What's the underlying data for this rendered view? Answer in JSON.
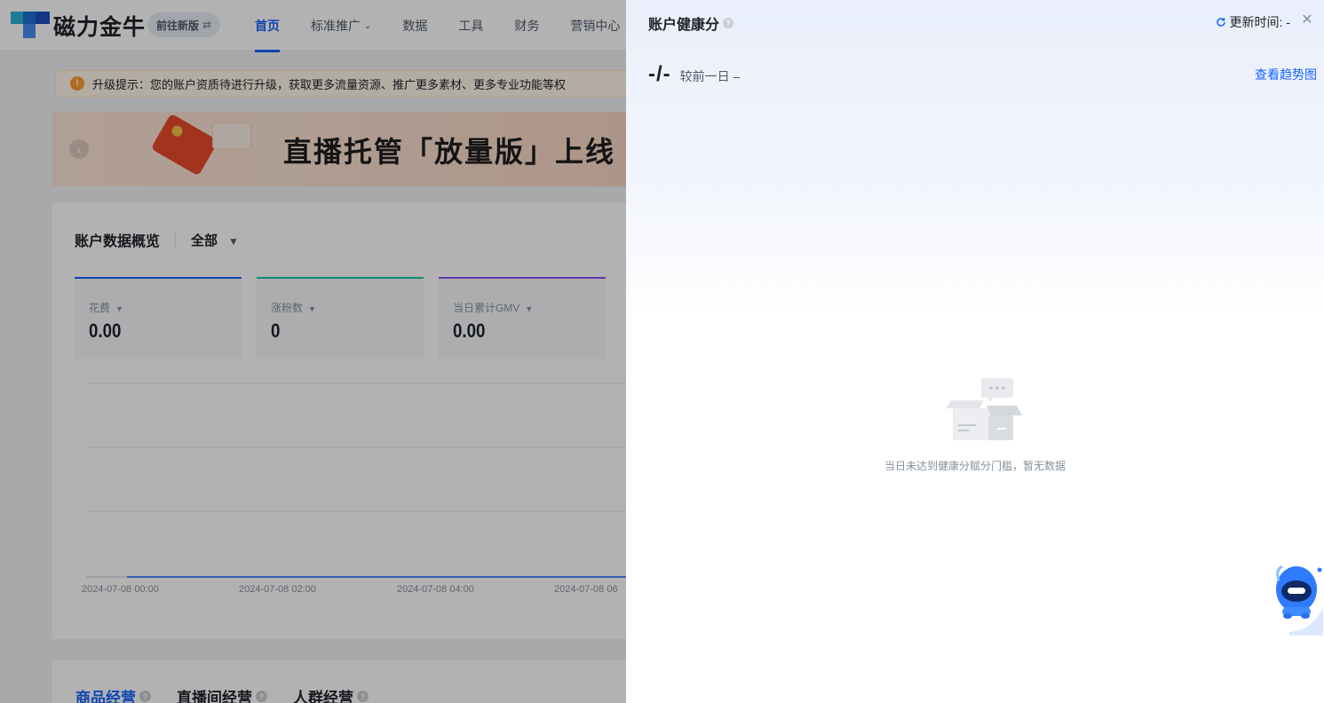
{
  "header": {
    "brand": "磁力金牛",
    "version_button": "前往新版",
    "version_icon": "swap-icon",
    "nav": [
      {
        "label": "首页",
        "active": true
      },
      {
        "label": "标准推广",
        "dropdown": true
      },
      {
        "label": "数据"
      },
      {
        "label": "工具"
      },
      {
        "label": "财务"
      },
      {
        "label": "营销中心"
      }
    ]
  },
  "notice": {
    "icon": "warning-icon",
    "text": "升级提示：您的账户资质待进行升级，获取更多流量资源、推广更多素材、更多专业功能等权"
  },
  "banner": {
    "title": "直播托管「放量版」上线"
  },
  "overview": {
    "title": "账户数据概览",
    "scope": "全部",
    "metrics": [
      {
        "label": "花费",
        "value": "0.00",
        "color": "#1664ff"
      },
      {
        "label": "涨粉数",
        "value": "0",
        "color": "#14c9a0"
      },
      {
        "label": "当日累计GMV",
        "value": "0.00",
        "color": "#8a4ff5"
      }
    ],
    "x_ticks": [
      "2024-07-08 00:00",
      "2024-07-08 02:00",
      "2024-07-08 04:00",
      "2024-07-08 06"
    ]
  },
  "bottom_tabs": [
    {
      "label": "商品经营",
      "active": true
    },
    {
      "label": "直播间经营"
    },
    {
      "label": "人群经营"
    }
  ],
  "drawer": {
    "title": "账户健康分",
    "update_label": "更新时间: -",
    "score": "-/-",
    "compare": "较前一日 –",
    "trend_link": "查看趋势图",
    "empty_text": "当日未达到健康分赋分门槛，暂无数据",
    "accent": "#1664ff"
  }
}
